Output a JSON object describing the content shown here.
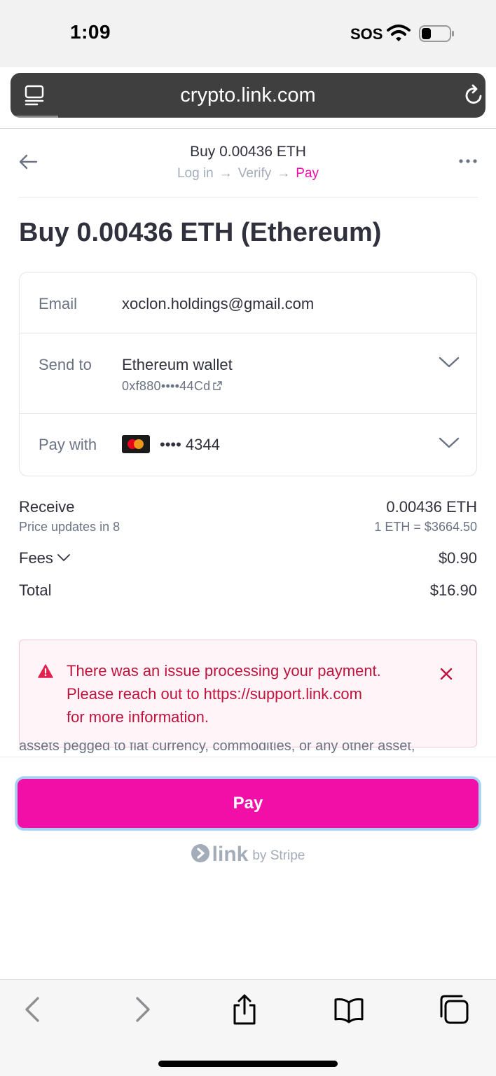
{
  "status_bar": {
    "time": "1:09",
    "carrier": "SOS"
  },
  "browser": {
    "url": "crypto.link.com"
  },
  "header": {
    "title": "Buy 0.00436 ETH",
    "steps": [
      "Log in",
      "Verify",
      "Pay"
    ],
    "active_step": "Pay"
  },
  "page_title": "Buy 0.00436 ETH (Ethereum)",
  "card": {
    "email_label": "Email",
    "email_value": "xoclon.holdings@gmail.com",
    "send_to_label": "Send to",
    "send_to_value": "Ethereum wallet",
    "send_to_address": "0xf880••••44Cd",
    "pay_with_label": "Pay with",
    "pay_with_value": "•••• 4344"
  },
  "summary": {
    "receive_label": "Receive",
    "receive_value": "0.00436 ETH",
    "price_updates": "Price updates in 8",
    "rate": "1 ETH = $3664.50",
    "fees_label": "Fees",
    "fees_value": "$0.90",
    "total_label": "Total",
    "total_value": "$16.90"
  },
  "error": {
    "line1": "There was an issue processing your payment.",
    "line2": "Please reach out to https://support.link.com",
    "line3": "for more information."
  },
  "legal_peek": "assets pegged to fiat currency, commodities, or any other asset,",
  "pay_button": "Pay",
  "brand": {
    "word": "link",
    "by": "by Stripe"
  },
  "colors": {
    "accent": "#f10fa8",
    "error": "#c0123c"
  }
}
